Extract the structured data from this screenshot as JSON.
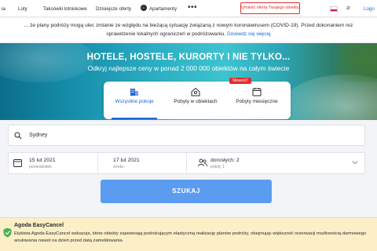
{
  "nav": {
    "items": [
      "Loty",
      "Taksówki lotniskowe",
      "Dzisiejsze oferty",
      "Apartamenty"
    ],
    "more": "•••",
    "list_button": "Umieść ofertę Twojego obiektu",
    "currency": "zł",
    "login": "Logo"
  },
  "notice": {
    "line1": "... że plany podróży mogą ulec zmianie ze względu na bieżącą sytuację związaną z nowym koronawirusem (COVID-19). Przed dokonaniem rez",
    "line2": "sprawdzenie lokalnych ograniczeń w podróżowaniu.",
    "link": "Dowiedz się więcej"
  },
  "hero": {
    "title": "HOTELE, HOSTELE, KURORTY I NIE TYLKO...",
    "subtitle": "Odkryj najlepsze ceny w ponad 2 000 000 obiektów na całym świecie"
  },
  "tabs": [
    {
      "label": "Wszystkie pokoje",
      "icon": "building-icon",
      "active": true
    },
    {
      "label": "Pobyty w obiektach",
      "icon": "home-icon",
      "active": false
    },
    {
      "label": "Pobyty miesięczne",
      "icon": "calendar-icon",
      "active": false
    }
  ],
  "new_badge": "Nowość!",
  "search": {
    "destination": "Sydney",
    "checkin": {
      "date": "15 lut 2021",
      "day": "poniedziałek"
    },
    "checkout": {
      "date": "17 lut 2021",
      "day": "środa"
    },
    "guests": {
      "adults": "dorosłych: 2",
      "rooms": "pokój: 1"
    },
    "button": "SZUKAJ"
  },
  "easycancel": {
    "title": "Agoda EasyCancel",
    "desc": "Etykieta Agoda EasyCancel wskazuje, które obiekty zapewniają podróżującym elastyczną realizację planów podróży, obejmując większość rezerwacji możliwością darmowego anulowania nawet na dzień przed datą zameldowania."
  },
  "colors": {
    "accent": "#2067da",
    "button": "#5b9cf0",
    "red": "#e12d2d",
    "banner": "#fcefc7"
  }
}
